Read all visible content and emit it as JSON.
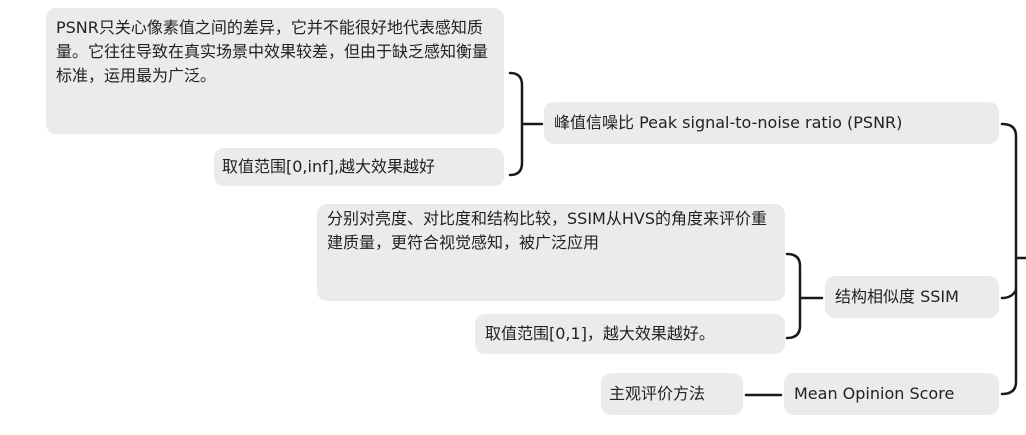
{
  "mindmap": {
    "psnr": {
      "label": "峰值信噪比 Peak signal-to-noise ratio (PSNR)",
      "note": "PSNR只关心像素值之间的差异，它并不能很好地代表感知质量。它往往导致在真实场景中效果较差，但由于缺乏感知衡量标准，运用最为广泛。",
      "range": "取值范围[0,inf],越大效果越好"
    },
    "ssim": {
      "label": "结构相似度 SSIM",
      "note": "分别对亮度、对比度和结构比较，SSIM从HVS的角度来评价重建质量，更符合视觉感知，被广泛应用",
      "range": "取值范围[0,1]，越大效果越好。"
    },
    "mos": {
      "label": "Mean Opinion Score",
      "note": "主观评价方法"
    }
  },
  "colors": {
    "node_fill": "#ebebeb",
    "line": "#1a1a1a",
    "text": "#222222"
  }
}
